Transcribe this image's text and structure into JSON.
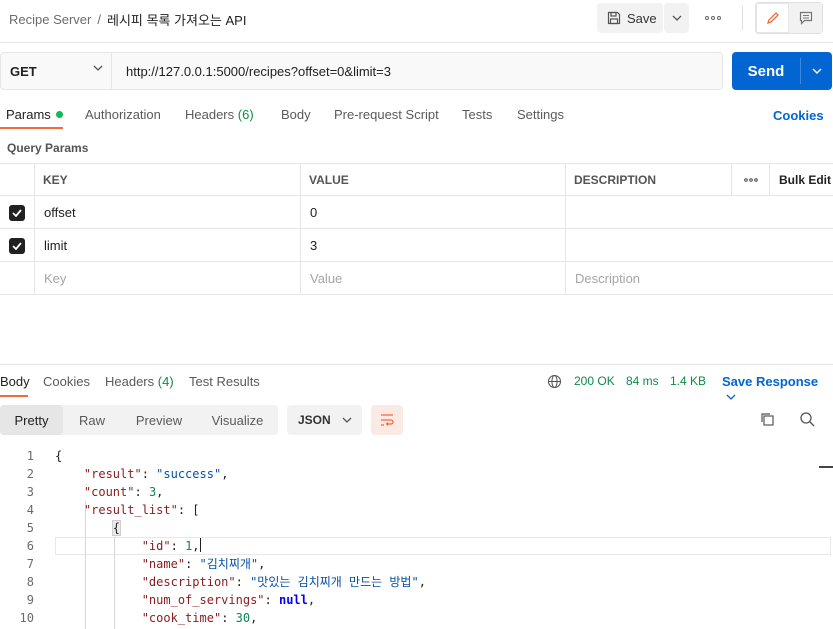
{
  "header": {
    "breadcrumb_parent": "Recipe Server",
    "breadcrumb_sep": "/",
    "breadcrumb_current": "레시피 목록 가져오는 API",
    "save_label": "Save"
  },
  "request": {
    "method": "GET",
    "url": "http://127.0.0.1:5000/recipes?offset=0&limit=3",
    "send_label": "Send"
  },
  "request_tabs": {
    "params": "Params",
    "authorization": "Authorization",
    "headers": "Headers",
    "headers_count": "(6)",
    "body": "Body",
    "pre_request": "Pre-request Script",
    "tests": "Tests",
    "settings": "Settings",
    "cookies": "Cookies"
  },
  "query_params": {
    "title": "Query Params",
    "col_key": "KEY",
    "col_value": "VALUE",
    "col_description": "DESCRIPTION",
    "bulk_edit": "Bulk Edit",
    "rows": [
      {
        "key": "offset",
        "value": "0"
      },
      {
        "key": "limit",
        "value": "3"
      }
    ],
    "placeholder_key": "Key",
    "placeholder_value": "Value",
    "placeholder_description": "Description"
  },
  "response_tabs": {
    "body": "Body",
    "cookies": "Cookies",
    "headers": "Headers",
    "headers_count": "(4)",
    "test_results": "Test Results"
  },
  "response_status": {
    "status": "200 OK",
    "time": "84 ms",
    "size": "1.4 KB",
    "save_response": "Save Response"
  },
  "view": {
    "pretty": "Pretty",
    "raw": "Raw",
    "preview": "Preview",
    "visualize": "Visualize",
    "format": "JSON"
  },
  "code": {
    "line_numbers": [
      "1",
      "2",
      "3",
      "4",
      "5",
      "6",
      "7",
      "8",
      "9",
      "10"
    ],
    "l1": "{",
    "l2_key": "\"result\"",
    "l2_val": "\"success\"",
    "l3_key": "\"count\"",
    "l3_val": "3",
    "l4_key": "\"result_list\"",
    "l4_rest": ": [",
    "l5": "{",
    "l6_key": "\"id\"",
    "l6_val": "1",
    "l7_key": "\"name\"",
    "l7_val": "\"김치찌개\"",
    "l8_key": "\"description\"",
    "l8_val": "\"맛있는 김치찌개 만드는 방법\"",
    "l9_key": "\"num_of_servings\"",
    "l9_val": "null",
    "l10_key": "\"cook_time\"",
    "l10_val": "30"
  },
  "colors": {
    "accent": "#f26b3a",
    "primary": "#0265d2",
    "success": "#0f8a4a"
  }
}
